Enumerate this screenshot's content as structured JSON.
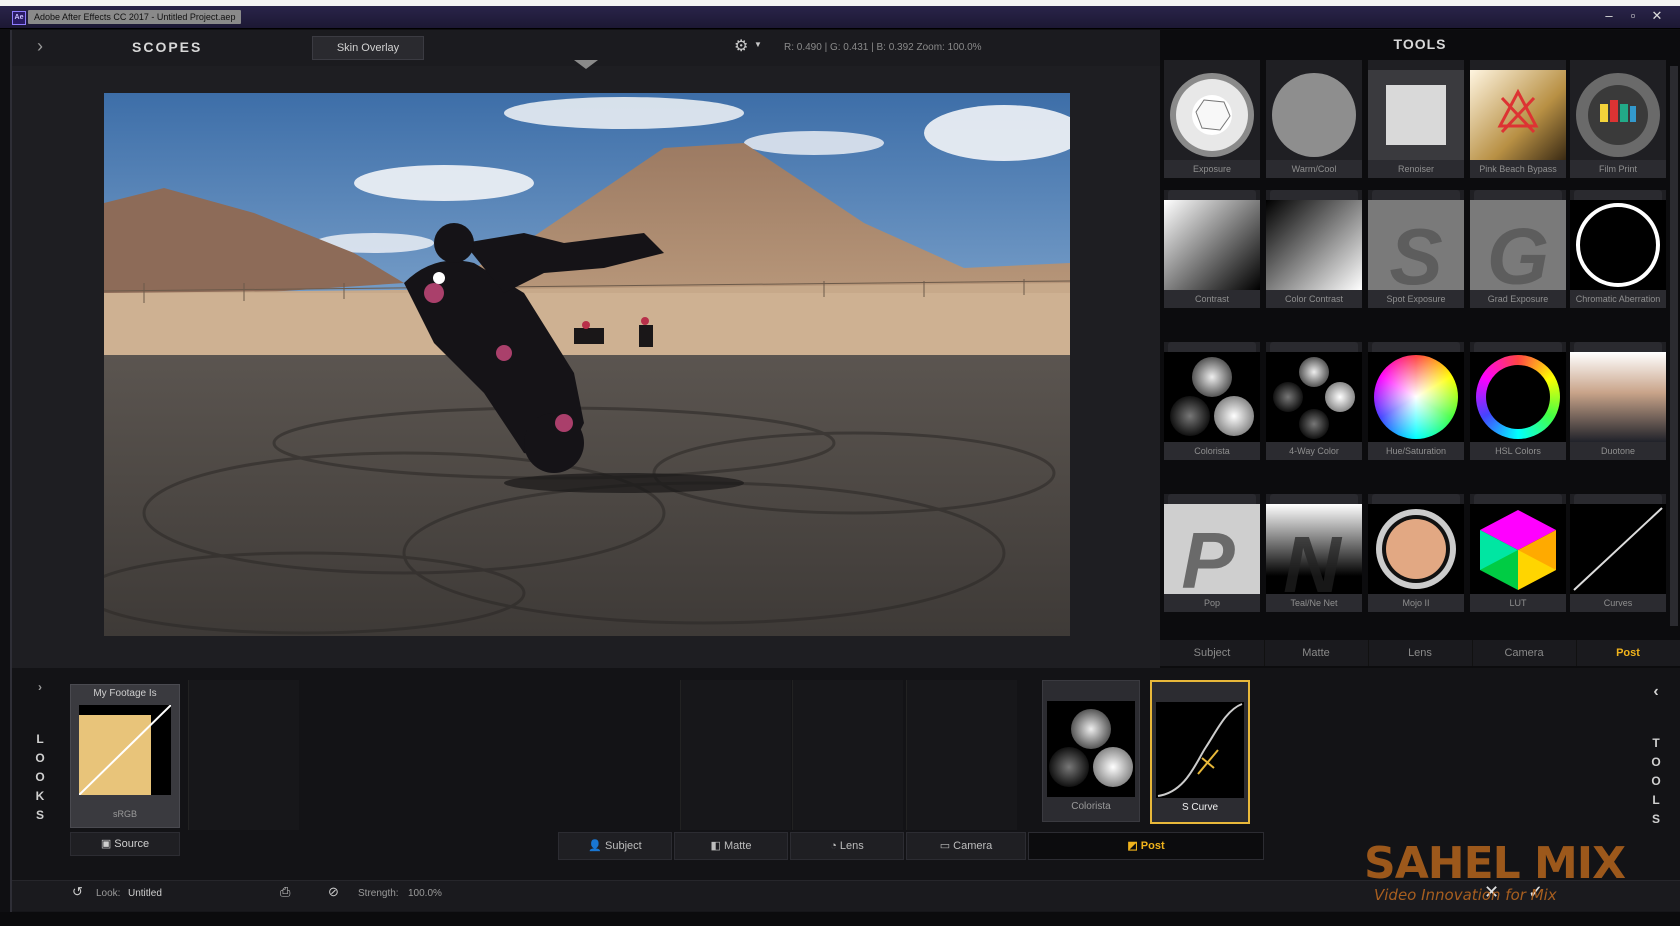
{
  "window": {
    "title": "Adobe After Effects CC 2017 - Untitled Project.aep"
  },
  "viewer": {
    "scopes_label": "SCOPES",
    "skin_overlay_label": "Skin Overlay",
    "readout": "R: 0.490 | G: 0.431 | B: 0.392   Zoom: 100.0%"
  },
  "tools": {
    "title": "TOOLS",
    "items": [
      {
        "label": "Exposure"
      },
      {
        "label": "Warm/Cool"
      },
      {
        "label": "Renoiser"
      },
      {
        "label": "Pink Beach Bypass"
      },
      {
        "label": "Film Print"
      },
      {
        "label": "Contrast"
      },
      {
        "label": "Color Contrast"
      },
      {
        "label": "Spot Exposure"
      },
      {
        "label": "Grad Exposure"
      },
      {
        "label": "Chromatic Aberration"
      },
      {
        "label": "Colorista"
      },
      {
        "label": "4-Way Color"
      },
      {
        "label": "Hue/Saturation"
      },
      {
        "label": "HSL Colors"
      },
      {
        "label": "Duotone"
      },
      {
        "label": "Pop"
      },
      {
        "label": "Teal/Ne Net"
      },
      {
        "label": "Mojo II"
      },
      {
        "label": "LUT"
      },
      {
        "label": "Curves"
      }
    ],
    "tabs": [
      "Subject",
      "Matte",
      "Lens",
      "Camera",
      "Post"
    ],
    "active_tab": "Post"
  },
  "looks": {
    "rail_label": [
      "L",
      "O",
      "O",
      "K",
      "S"
    ],
    "card_name": "My Footage Is",
    "card_sub": "sRGB",
    "source_label": "Source"
  },
  "stack": {
    "items": [
      {
        "label": "Colorista"
      },
      {
        "label": "S Curve"
      }
    ],
    "categories": [
      "Subject",
      "Matte",
      "Lens",
      "Camera",
      "Post"
    ],
    "active_category": "Post"
  },
  "right_rail": {
    "label": [
      "T",
      "O",
      "O",
      "L",
      "S"
    ]
  },
  "status": {
    "look_label": "Look:",
    "look_value": "Untitled",
    "strength_label": "Strength:",
    "strength_value": "100.0%"
  },
  "watermark": {
    "main": "SAHEL MIX",
    "sub": "Video Innovation for Mix"
  },
  "colors": {
    "accent": "#f0b31c",
    "panel": "#16161a"
  }
}
